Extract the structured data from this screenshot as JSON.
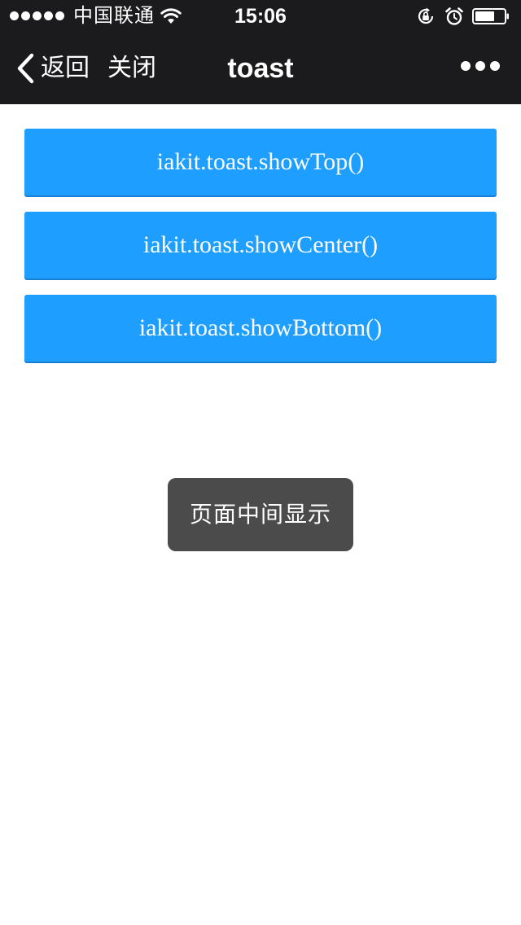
{
  "status_bar": {
    "carrier": "中国联通",
    "time": "15:06",
    "icons": [
      "signal-icon",
      "wifi-icon",
      "rotation-lock-icon",
      "alarm-icon",
      "battery-icon"
    ]
  },
  "nav": {
    "back_label": "返回",
    "close_label": "关闭",
    "title": "toast",
    "more_icon": "more-icon"
  },
  "buttons": {
    "show_top": "iakit.toast.showTop()",
    "show_center": "iakit.toast.showCenter()",
    "show_bottom": "iakit.toast.showBottom()"
  },
  "toast": {
    "message": "页面中间显示"
  },
  "colors": {
    "bar_background": "#1b1b1d",
    "button_background": "#1e9fff",
    "toast_background": "#4b4b4b"
  }
}
